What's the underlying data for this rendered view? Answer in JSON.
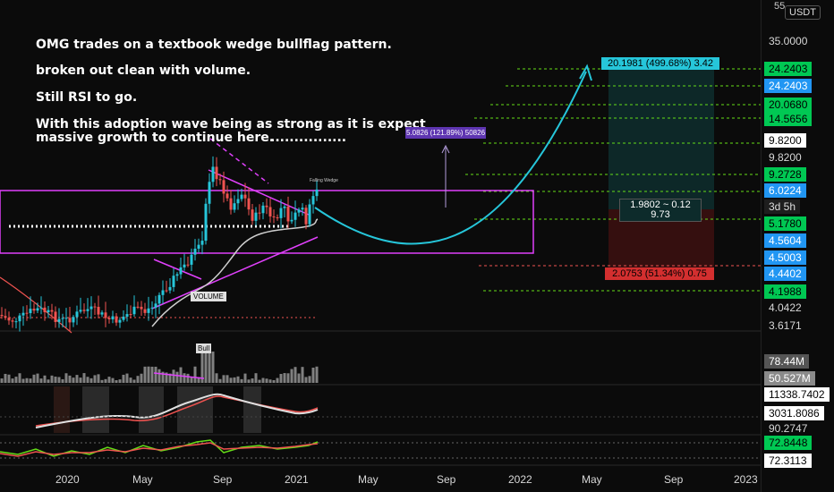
{
  "annotations": {
    "line1": "OMG trades on a textbook wedge bullflag pattern.",
    "line2": "broken out clean with volume.",
    "line3": "Still RSI to go.",
    "line4": "With this adoption wave being as strong as it is expect",
    "line5": "massive growth to continue here.",
    "dots": "................"
  },
  "chart_labels": {
    "target_long": "20.1981 (499.68%) 3.42",
    "target_mid": "5.0826 (121.89%) 50826",
    "position_top": "1.9802 ~ 0.12",
    "position_mid": "9.73",
    "stop": "2.0753 (51.34%) 0.75",
    "bull": "Bull",
    "volume": "VOLUME",
    "pattern_label": "Falling Wedge"
  },
  "price_axis": {
    "currency": "USDT",
    "top_cut": "55",
    "labels": [
      {
        "text": "35.0000",
        "style": "plain"
      },
      {
        "text": "24.2403",
        "style": "green"
      },
      {
        "text": "24.2403",
        "style": "blue"
      },
      {
        "text": "20.0680",
        "style": "green"
      },
      {
        "text": "14.5656",
        "style": "green"
      },
      {
        "text": "9.8200",
        "style": "white"
      },
      {
        "text": "9.8200",
        "style": "plain"
      },
      {
        "text": "9.2728",
        "style": "green"
      },
      {
        "text": "6.0224",
        "style": "blue"
      },
      {
        "text": "3d 5h",
        "style": "dark"
      },
      {
        "text": "5.1780",
        "style": "green"
      },
      {
        "text": "4.5604",
        "style": "blue"
      },
      {
        "text": "4.5003",
        "style": "blue"
      },
      {
        "text": "4.4402",
        "style": "blue"
      },
      {
        "text": "4.1988",
        "style": "green"
      },
      {
        "text": "4.0422",
        "style": "plain"
      },
      {
        "text": "3.6171",
        "style": "plain"
      }
    ],
    "volume_labels": [
      {
        "text": "78.44M",
        "style": "grey"
      },
      {
        "text": "50.527M",
        "style": "lightgrey"
      }
    ],
    "indicator1_labels": [
      {
        "text": "11338.7402",
        "style": "white"
      },
      {
        "text": "3031.8086",
        "style": "white"
      },
      {
        "text": "90.2747",
        "style": "plain"
      }
    ],
    "indicator2_labels": [
      {
        "text": "72.8448",
        "style": "green"
      },
      {
        "text": "72.3113",
        "style": "white"
      }
    ]
  },
  "time_axis": [
    "2020",
    "May",
    "Sep",
    "2021",
    "May",
    "Sep",
    "2022",
    "May",
    "Sep",
    "2023"
  ],
  "colors": {
    "background": "#0b0b0b",
    "up": "#26c6da",
    "down": "#ef5350",
    "wedge": "#e040fb",
    "projection": "#26c6da",
    "target_green": "#00c853",
    "target_blue": "#2196f3"
  }
}
